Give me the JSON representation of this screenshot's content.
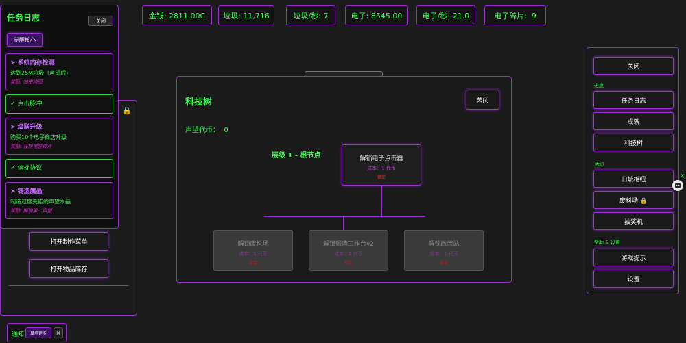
{
  "stats": [
    {
      "label": "金钱: 2811.00C"
    },
    {
      "label": "垃圾: 11,716"
    },
    {
      "label": "垃圾/秒: 7"
    },
    {
      "label": "电子: 8545.00"
    },
    {
      "label": "电子/秒: 21.0"
    },
    {
      "label": "电子碎片:  9"
    }
  ],
  "quest_log": {
    "title": "任务日志",
    "close_label": "关闭",
    "awaken_label": "觉醒核心",
    "quests": [
      {
        "name": "➤ 系统内存检测",
        "desc": "达到25M垃圾（声望后)",
        "reward": "奖励: 加密纯图",
        "done": false
      },
      {
        "name": "✓ 点击脉冲",
        "done": true
      },
      {
        "name": "➤ 级联升级",
        "desc": "购买10个电子商店升级",
        "reward": "奖励: 狂热电容碎片",
        "done": false
      },
      {
        "name": "✓ 信标协议",
        "done": true
      },
      {
        "name": "➤ 铸造魔晶",
        "desc": "制造过度充能的声望水晶",
        "reward": "奖励: 解锁第二声望",
        "done": false
      }
    ]
  },
  "left_panel": {
    "craft_label": "打开制作菜单",
    "inventory_label": "打开物品库存"
  },
  "tech_tree": {
    "title": "科技树",
    "close_label": "关闭",
    "prestige_label": "声望代币：  0",
    "tier_label": "层级 1 - 根节点",
    "root": {
      "name": "解锁电子点击器",
      "cost": "成本：1 代币",
      "status": "锁定"
    },
    "children": [
      {
        "name": "解锁废料场",
        "cost": "成本：1 代币",
        "status": "锁定"
      },
      {
        "name": "解锁锻造工作台v2",
        "cost": "成本：1 代币",
        "status": "锁定"
      },
      {
        "name": "解锁改装站",
        "cost": "成本：1 代币",
        "status": "锁定"
      }
    ]
  },
  "right_panel": {
    "close_label": "关闭",
    "sections": {
      "progress": "进度",
      "activity": "活动",
      "help": "帮助 & 设置"
    },
    "buttons": {
      "quest_log": "任务日志",
      "achievements": "成就",
      "tech_tree": "科技树",
      "old_city": "旧城枢纽",
      "scrapyard": "废料场 🔒",
      "lottery": "抽奖机",
      "tips": "游戏提示",
      "settings": "设置"
    }
  },
  "notification": {
    "label": "通知",
    "show_more": "显示更多",
    "close": "×"
  },
  "colors": {
    "accent_purple": "#9a2bd1",
    "text_green": "#36ff4e",
    "reward_magenta": "#e02fd0",
    "locked_red": "#ff2b2b"
  },
  "icons": [
    "lock-icon",
    "robot-face-icon",
    "close-x-icon"
  ]
}
